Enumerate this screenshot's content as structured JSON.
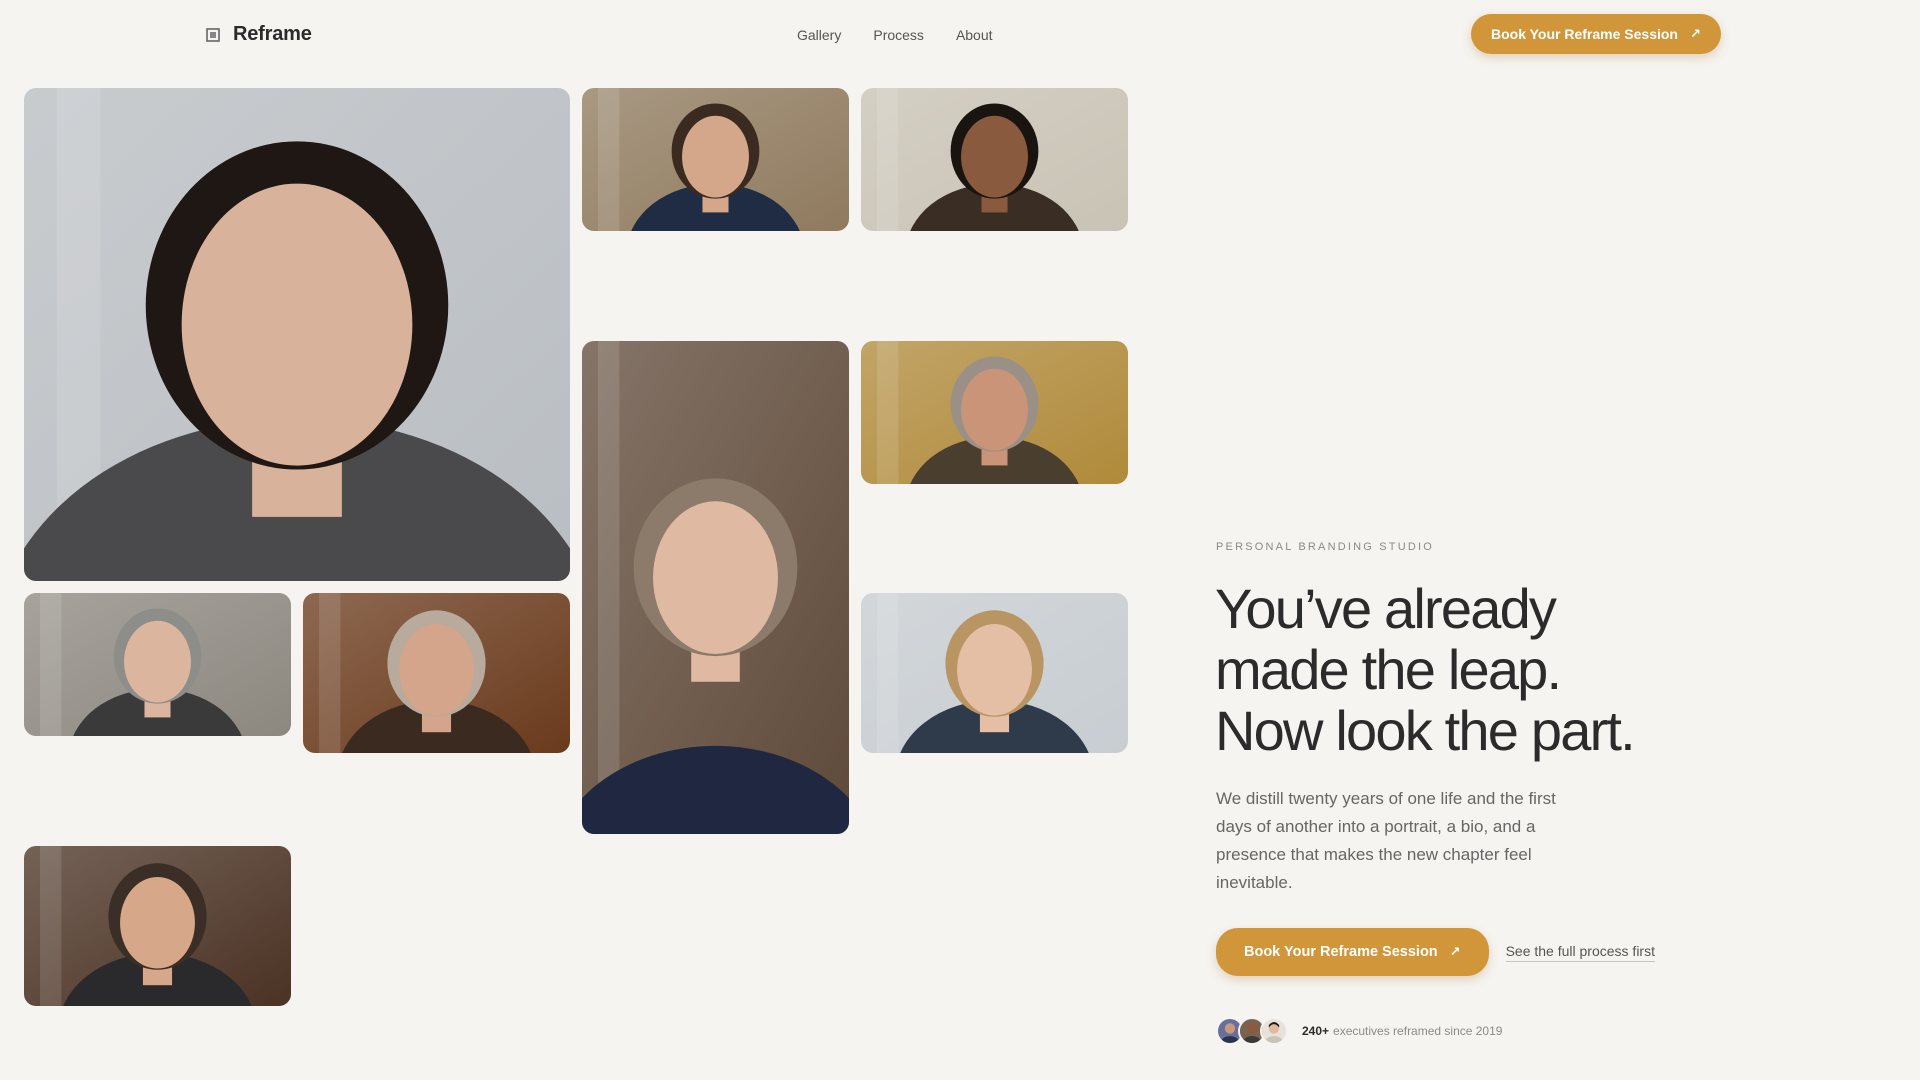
{
  "header": {
    "brand": "Reframe",
    "nav": [
      "Gallery",
      "Process",
      "About"
    ],
    "cta_label": "Book Your Reframe Session",
    "cta_icon": "arrow-up-right-icon"
  },
  "gallery": {
    "tiles": [
      {
        "name": "portrait-woman-dark-hair",
        "bg": "#b9bec3",
        "hair": "#1e1714",
        "skin": "#d9b29b",
        "cloth": "#4a4a4c"
      },
      {
        "name": "portrait-man-smiling-bookshelf",
        "bg": "#8f7a5e",
        "hair": "#3a2a1f",
        "skin": "#d5a78a",
        "cloth": "#1f2c44"
      },
      {
        "name": "portrait-woman-curly-hair",
        "bg": "#c9c3b5",
        "hair": "#1a1410",
        "skin": "#8a5a3e",
        "cloth": "#3a2d24"
      },
      {
        "name": "portrait-woman-silver-hair",
        "bg": "#5f4a3a",
        "hair": "#8c7a6a",
        "skin": "#e0b9a3",
        "cloth": "#1f2840"
      },
      {
        "name": "portrait-man-balding-outdoors",
        "bg": "#b08a3a",
        "hair": "#9a9088",
        "skin": "#c99478",
        "cloth": "#4a3f2f"
      },
      {
        "name": "portrait-woman-short-grey-hair",
        "bg": "#8c8880",
        "hair": "#8d8d8a",
        "skin": "#dcb59e",
        "cloth": "#3a3a3a"
      },
      {
        "name": "portrait-man-balding-wood",
        "bg": "#6a3a1c",
        "hair": "#b8aa9c",
        "skin": "#d4a58a",
        "cloth": "#3a2a20"
      },
      {
        "name": "portrait-woman-blonde-laughing",
        "bg": "#c7cdd2",
        "hair": "#b99563",
        "skin": "#e4bfa5",
        "cloth": "#2f3a4a"
      },
      {
        "name": "portrait-man-library",
        "bg": "#4a3224",
        "hair": "#3a2e26",
        "skin": "#d6a789",
        "cloth": "#2a2a2c"
      }
    ]
  },
  "hero": {
    "eyebrow": "PERSONAL BRANDING STUDIO",
    "headline": [
      "You’ve already",
      "made the leap.",
      "Now look the part."
    ],
    "lead": "We distill twenty years of one life and the first days of another into a portrait, a bio, and a presence that makes the new chapter feel inevitable.",
    "cta_label": "Book Your Reframe Session",
    "secondary_link": "See the full process first",
    "social_count": "240+",
    "social_text": "executives reframed since 2019"
  },
  "colors": {
    "accent": "#d1953a",
    "background": "#f6f4f0",
    "text": "#2b2b2b"
  }
}
